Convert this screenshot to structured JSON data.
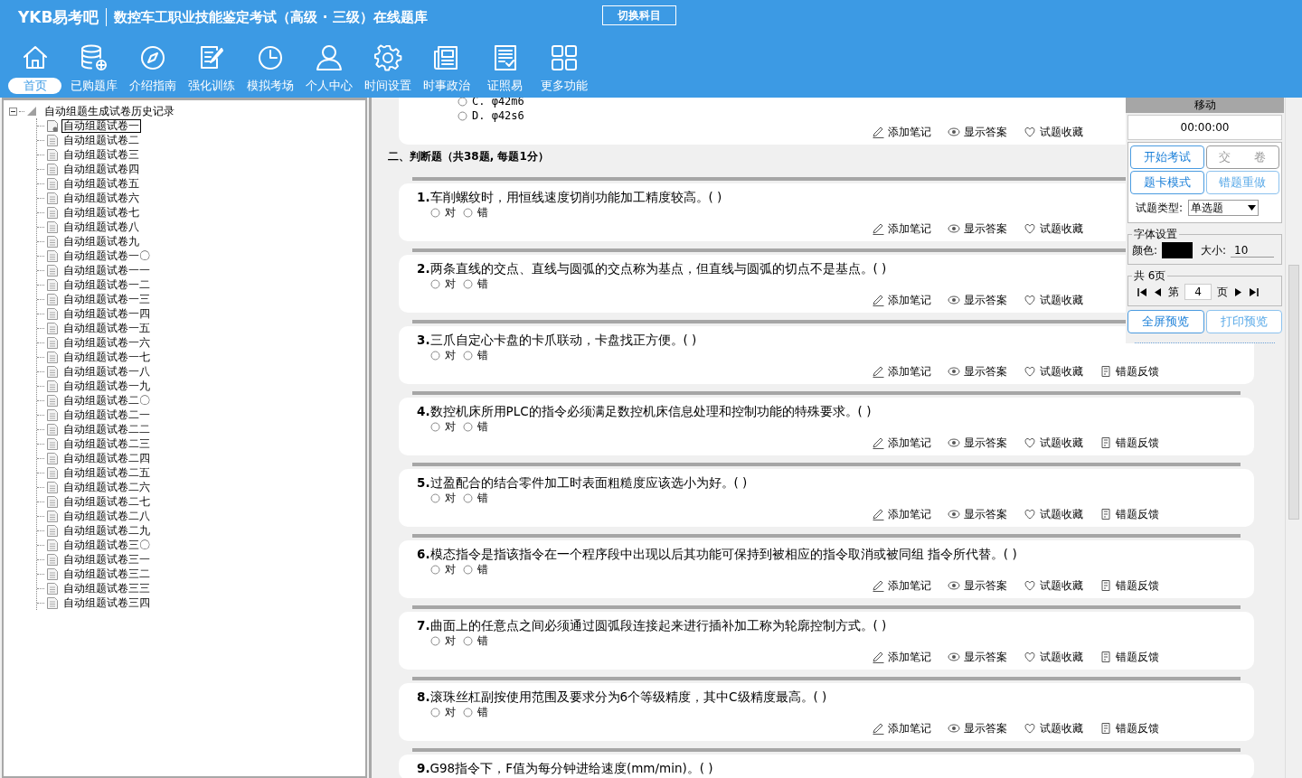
{
  "header": {
    "logo": "YKB易考吧",
    "title": "数控车工职业技能鉴定考试（高级 · 三级）在线题库",
    "switch_button": "切换科目"
  },
  "nav": [
    {
      "label": "首页",
      "selected": true
    },
    {
      "label": "已购题库",
      "selected": false
    },
    {
      "label": "介绍指南",
      "selected": false
    },
    {
      "label": "强化训练",
      "selected": false
    },
    {
      "label": "模拟考场",
      "selected": false
    },
    {
      "label": "个人中心",
      "selected": false
    },
    {
      "label": "时间设置",
      "selected": false
    },
    {
      "label": "时事政治",
      "selected": false
    },
    {
      "label": "证照易",
      "selected": false
    },
    {
      "label": "更多功能",
      "selected": false
    }
  ],
  "tree": {
    "label": "自动组题生成试卷历史记录",
    "expanded": true,
    "children": [
      {
        "label": "自动组题试卷一",
        "selected": true
      },
      {
        "label": "自动组题试卷二",
        "selected": false
      },
      {
        "label": "自动组题试卷三",
        "selected": false
      },
      {
        "label": "自动组题试卷四",
        "selected": false
      },
      {
        "label": "自动组题试卷五",
        "selected": false
      },
      {
        "label": "自动组题试卷六",
        "selected": false
      },
      {
        "label": "自动组题试卷七",
        "selected": false
      },
      {
        "label": "自动组题试卷八",
        "selected": false
      },
      {
        "label": "自动组题试卷九",
        "selected": false
      },
      {
        "label": "自动组题试卷一〇",
        "selected": false
      },
      {
        "label": "自动组题试卷一一",
        "selected": false
      },
      {
        "label": "自动组题试卷一二",
        "selected": false
      },
      {
        "label": "自动组题试卷一三",
        "selected": false
      },
      {
        "label": "自动组题试卷一四",
        "selected": false
      },
      {
        "label": "自动组题试卷一五",
        "selected": false
      },
      {
        "label": "自动组题试卷一六",
        "selected": false
      },
      {
        "label": "自动组题试卷一七",
        "selected": false
      },
      {
        "label": "自动组题试卷一八",
        "selected": false
      },
      {
        "label": "自动组题试卷一九",
        "selected": false
      },
      {
        "label": "自动组题试卷二〇",
        "selected": false
      },
      {
        "label": "自动组题试卷二一",
        "selected": false
      },
      {
        "label": "自动组题试卷二二",
        "selected": false
      },
      {
        "label": "自动组题试卷二三",
        "selected": false
      },
      {
        "label": "自动组题试卷二四",
        "selected": false
      },
      {
        "label": "自动组题试卷二五",
        "selected": false
      },
      {
        "label": "自动组题试卷二六",
        "selected": false
      },
      {
        "label": "自动组题试卷二七",
        "selected": false
      },
      {
        "label": "自动组题试卷二八",
        "selected": false
      },
      {
        "label": "自动组题试卷二九",
        "selected": false
      },
      {
        "label": "自动组题试卷三〇",
        "selected": false
      },
      {
        "label": "自动组题试卷三一",
        "selected": false
      },
      {
        "label": "自动组题试卷三二",
        "selected": false
      },
      {
        "label": "自动组题试卷三三",
        "selected": false
      },
      {
        "label": "自动组题试卷三四",
        "selected": false
      }
    ]
  },
  "content": {
    "previous_question": {
      "options": [
        {
          "letter": "C.",
          "text": "φ42m6",
          "selected": false
        },
        {
          "letter": "D.",
          "text": "φ42s6",
          "selected": false
        }
      ],
      "actions": [
        {
          "kind": "note",
          "label": "添加笔记"
        },
        {
          "kind": "answer",
          "label": "显示答案"
        },
        {
          "kind": "favorite",
          "label": "试题收藏"
        }
      ]
    },
    "section_title": "二、判断题（共38题, 每题1分）",
    "questions": [
      {
        "number": "1.",
        "text": "车削螺纹时，用恒线速度切削功能加工精度较高。( )",
        "options": [
          {
            "label": "对",
            "selected": false
          },
          {
            "label": "错",
            "selected": false
          }
        ],
        "actions": [
          {
            "kind": "note",
            "label": "添加笔记"
          },
          {
            "kind": "answer",
            "label": "显示答案"
          },
          {
            "kind": "favorite",
            "label": "试题收藏"
          }
        ]
      },
      {
        "number": "2.",
        "text": "两条直线的交点、直线与圆弧的交点称为基点，但直线与圆弧的切点不是基点。( )",
        "options": [
          {
            "label": "对",
            "selected": false
          },
          {
            "label": "错",
            "selected": false
          }
        ],
        "actions": [
          {
            "kind": "note",
            "label": "添加笔记"
          },
          {
            "kind": "answer",
            "label": "显示答案"
          },
          {
            "kind": "favorite",
            "label": "试题收藏"
          }
        ]
      },
      {
        "number": "3.",
        "text": "三爪自定心卡盘的卡爪联动，卡盘找正方便。( )",
        "options": [
          {
            "label": "对",
            "selected": false
          },
          {
            "label": "错",
            "selected": false
          }
        ],
        "actions": [
          {
            "kind": "note",
            "label": "添加笔记"
          },
          {
            "kind": "answer",
            "label": "显示答案"
          },
          {
            "kind": "favorite",
            "label": "试题收藏"
          },
          {
            "kind": "feedback",
            "label": "错题反馈"
          }
        ]
      },
      {
        "number": "4.",
        "text": "数控机床所用PLC的指令必须满足数控机床信息处理和控制功能的特殊要求。( )",
        "options": [
          {
            "label": "对",
            "selected": false
          },
          {
            "label": "错",
            "selected": false
          }
        ],
        "actions": [
          {
            "kind": "note",
            "label": "添加笔记"
          },
          {
            "kind": "answer",
            "label": "显示答案"
          },
          {
            "kind": "favorite",
            "label": "试题收藏"
          },
          {
            "kind": "feedback",
            "label": "错题反馈"
          }
        ]
      },
      {
        "number": "5.",
        "text": "过盈配合的结合零件加工时表面粗糙度应该选小为好。( )",
        "options": [
          {
            "label": "对",
            "selected": false
          },
          {
            "label": "错",
            "selected": false
          }
        ],
        "actions": [
          {
            "kind": "note",
            "label": "添加笔记"
          },
          {
            "kind": "answer",
            "label": "显示答案"
          },
          {
            "kind": "favorite",
            "label": "试题收藏"
          },
          {
            "kind": "feedback",
            "label": "错题反馈"
          }
        ]
      },
      {
        "number": "6.",
        "text": "模态指令是指该指令在一个程序段中出现以后其功能可保持到被相应的指令取消或被同组 指令所代替。( )",
        "options": [
          {
            "label": "对",
            "selected": false
          },
          {
            "label": "错",
            "selected": false
          }
        ],
        "actions": [
          {
            "kind": "note",
            "label": "添加笔记"
          },
          {
            "kind": "answer",
            "label": "显示答案"
          },
          {
            "kind": "favorite",
            "label": "试题收藏"
          },
          {
            "kind": "feedback",
            "label": "错题反馈"
          }
        ]
      },
      {
        "number": "7.",
        "text": "曲面上的任意点之间必须通过圆弧段连接起来进行插补加工称为轮廓控制方式。( )",
        "options": [
          {
            "label": "对",
            "selected": false
          },
          {
            "label": "错",
            "selected": false
          }
        ],
        "actions": [
          {
            "kind": "note",
            "label": "添加笔记"
          },
          {
            "kind": "answer",
            "label": "显示答案"
          },
          {
            "kind": "favorite",
            "label": "试题收藏"
          },
          {
            "kind": "feedback",
            "label": "错题反馈"
          }
        ]
      },
      {
        "number": "8.",
        "text": "滚珠丝杠副按使用范围及要求分为6个等级精度，其中C级精度最高。( )",
        "options": [
          {
            "label": "对",
            "selected": false
          },
          {
            "label": "错",
            "selected": false
          }
        ],
        "actions": [
          {
            "kind": "note",
            "label": "添加笔记"
          },
          {
            "kind": "answer",
            "label": "显示答案"
          },
          {
            "kind": "favorite",
            "label": "试题收藏"
          },
          {
            "kind": "feedback",
            "label": "错题反馈"
          }
        ]
      },
      {
        "number": "9.",
        "text": "G98指令下，F值为每分钟进给速度(mm/min)。( )"
      }
    ]
  },
  "panel": {
    "title": "移动",
    "timer": "00:00:00",
    "buttons": [
      {
        "label": "开始考试",
        "kind": "primary"
      },
      {
        "label": "交　　卷",
        "kind": "disabled"
      },
      {
        "label": "题卡模式",
        "kind": "primary"
      },
      {
        "label": "错题重做",
        "kind": "secondary"
      }
    ],
    "type_label": "试题类型:",
    "type_value": "单选题",
    "font_group": "字体设置",
    "color_label": "颜色:",
    "font_swatch": {
      "color": "#000000"
    },
    "size_label": "大小:",
    "size_value": "10",
    "pages_group": "共 6页",
    "page_prefix": "第",
    "page_value": "4",
    "page_suffix": "页",
    "preview_buttons": [
      {
        "label": "全屏预览",
        "kind": "primary"
      },
      {
        "label": "打印预览",
        "kind": "secondary"
      }
    ]
  }
}
